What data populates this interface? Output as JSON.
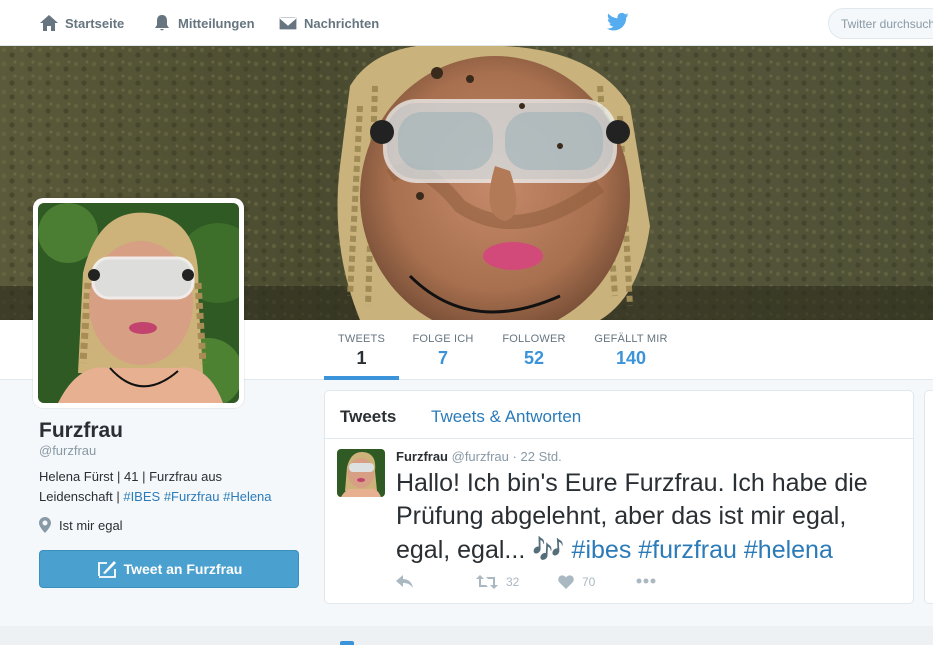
{
  "nav": {
    "home_label": "Startseite",
    "notifications_label": "Mitteilungen",
    "messages_label": "Nachrichten",
    "search_placeholder": "Twitter durchsuchen"
  },
  "stats": [
    {
      "label": "TWEETS",
      "value": "1"
    },
    {
      "label": "FOLGE ICH",
      "value": "7"
    },
    {
      "label": "FOLLOWER",
      "value": "52"
    },
    {
      "label": "GEFÄLLT MIR",
      "value": "140"
    }
  ],
  "profile": {
    "name": "Furzfrau",
    "handle": "@furzfrau",
    "bio_text": "Helena Fürst | 41 | Furzfrau aus Leidenschaft |",
    "bio_tags": [
      "#IBES",
      "#Furzfrau",
      "#Helena"
    ],
    "location": "Ist mir egal",
    "tweet_to_label": "Tweet an Furzfrau"
  },
  "timeline": {
    "tab_tweets": "Tweets",
    "tab_replies": "Tweets & Antworten",
    "tweet": {
      "author_name": "Furzfrau",
      "author_handle": "@furzfrau",
      "separator": "·",
      "time": "22 Std.",
      "text": "Hallo! Ich bin's Eure Furzfrau. Ich habe die Prüfung abgelehnt, aber das ist mir egal, egal, egal...",
      "emoji": "🎶",
      "hashtags": [
        "#ibes",
        "#furzfrau",
        "#helena"
      ],
      "retweets": "32",
      "likes": "70"
    }
  },
  "colors": {
    "accent": "#3b94d9",
    "link": "#2b7bb9",
    "button": "#4aa0cf"
  }
}
